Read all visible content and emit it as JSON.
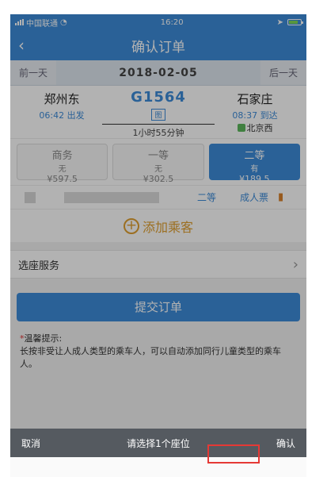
{
  "status": {
    "carrier": "中国联通",
    "time": "16:20"
  },
  "nav": {
    "title": "确认订单"
  },
  "datebar": {
    "prev": "前一天",
    "date": "2018-02-05",
    "next": "后一天"
  },
  "trip": {
    "from_name": "郑州东",
    "from_time": "06:42 出发",
    "train_no": "G1564",
    "train_badge": "图",
    "duration": "1小时55分钟",
    "to_name": "石家庄",
    "to_time": "08:37 到达",
    "to_via": "北京西"
  },
  "seats": [
    {
      "cls": "商务",
      "stock": "无",
      "price": "¥597.5"
    },
    {
      "cls": "一等",
      "stock": "无",
      "price": "¥302.5"
    },
    {
      "cls": "二等",
      "stock": "有",
      "price": "¥189.5"
    }
  ],
  "passenger": {
    "seat": "二等",
    "ticket": "成人票"
  },
  "add": {
    "label": "添加乘客"
  },
  "service": {
    "label": "选座服务"
  },
  "submit": {
    "label": "提交订单"
  },
  "tips": {
    "title": "温馨提示:",
    "text": "长按非受让人成人类型的乘车人，可以自动添加同行儿童类型的乘车人。"
  },
  "picker": {
    "cancel": "取消",
    "prompt": "请选择1个座位",
    "confirm": "确认"
  }
}
